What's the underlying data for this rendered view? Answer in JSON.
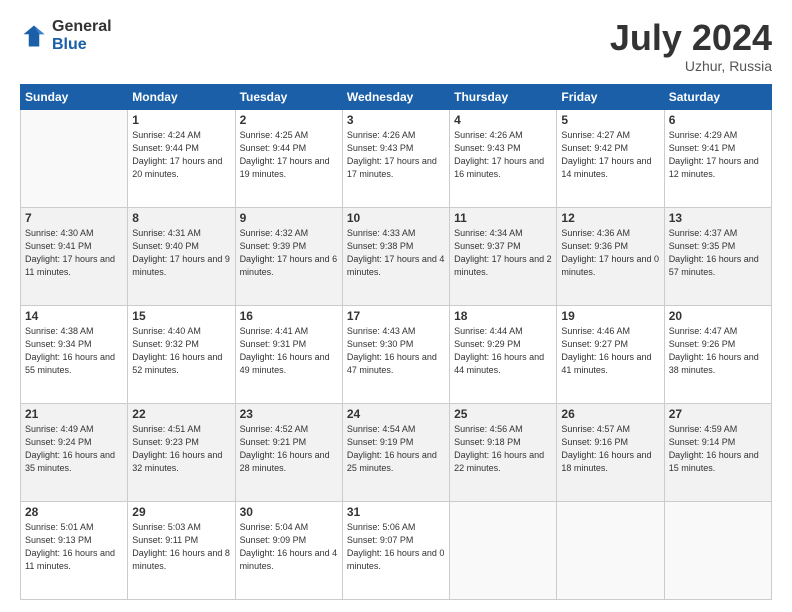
{
  "header": {
    "logo_general": "General",
    "logo_blue": "Blue",
    "month_title": "July 2024",
    "location": "Uzhur, Russia"
  },
  "weekdays": [
    "Sunday",
    "Monday",
    "Tuesday",
    "Wednesday",
    "Thursday",
    "Friday",
    "Saturday"
  ],
  "weeks": [
    [
      {
        "day": "",
        "sunrise": "",
        "sunset": "",
        "daylight": ""
      },
      {
        "day": "1",
        "sunrise": "Sunrise: 4:24 AM",
        "sunset": "Sunset: 9:44 PM",
        "daylight": "Daylight: 17 hours and 20 minutes."
      },
      {
        "day": "2",
        "sunrise": "Sunrise: 4:25 AM",
        "sunset": "Sunset: 9:44 PM",
        "daylight": "Daylight: 17 hours and 19 minutes."
      },
      {
        "day": "3",
        "sunrise": "Sunrise: 4:26 AM",
        "sunset": "Sunset: 9:43 PM",
        "daylight": "Daylight: 17 hours and 17 minutes."
      },
      {
        "day": "4",
        "sunrise": "Sunrise: 4:26 AM",
        "sunset": "Sunset: 9:43 PM",
        "daylight": "Daylight: 17 hours and 16 minutes."
      },
      {
        "day": "5",
        "sunrise": "Sunrise: 4:27 AM",
        "sunset": "Sunset: 9:42 PM",
        "daylight": "Daylight: 17 hours and 14 minutes."
      },
      {
        "day": "6",
        "sunrise": "Sunrise: 4:29 AM",
        "sunset": "Sunset: 9:41 PM",
        "daylight": "Daylight: 17 hours and 12 minutes."
      }
    ],
    [
      {
        "day": "7",
        "sunrise": "Sunrise: 4:30 AM",
        "sunset": "Sunset: 9:41 PM",
        "daylight": "Daylight: 17 hours and 11 minutes."
      },
      {
        "day": "8",
        "sunrise": "Sunrise: 4:31 AM",
        "sunset": "Sunset: 9:40 PM",
        "daylight": "Daylight: 17 hours and 9 minutes."
      },
      {
        "day": "9",
        "sunrise": "Sunrise: 4:32 AM",
        "sunset": "Sunset: 9:39 PM",
        "daylight": "Daylight: 17 hours and 6 minutes."
      },
      {
        "day": "10",
        "sunrise": "Sunrise: 4:33 AM",
        "sunset": "Sunset: 9:38 PM",
        "daylight": "Daylight: 17 hours and 4 minutes."
      },
      {
        "day": "11",
        "sunrise": "Sunrise: 4:34 AM",
        "sunset": "Sunset: 9:37 PM",
        "daylight": "Daylight: 17 hours and 2 minutes."
      },
      {
        "day": "12",
        "sunrise": "Sunrise: 4:36 AM",
        "sunset": "Sunset: 9:36 PM",
        "daylight": "Daylight: 17 hours and 0 minutes."
      },
      {
        "day": "13",
        "sunrise": "Sunrise: 4:37 AM",
        "sunset": "Sunset: 9:35 PM",
        "daylight": "Daylight: 16 hours and 57 minutes."
      }
    ],
    [
      {
        "day": "14",
        "sunrise": "Sunrise: 4:38 AM",
        "sunset": "Sunset: 9:34 PM",
        "daylight": "Daylight: 16 hours and 55 minutes."
      },
      {
        "day": "15",
        "sunrise": "Sunrise: 4:40 AM",
        "sunset": "Sunset: 9:32 PM",
        "daylight": "Daylight: 16 hours and 52 minutes."
      },
      {
        "day": "16",
        "sunrise": "Sunrise: 4:41 AM",
        "sunset": "Sunset: 9:31 PM",
        "daylight": "Daylight: 16 hours and 49 minutes."
      },
      {
        "day": "17",
        "sunrise": "Sunrise: 4:43 AM",
        "sunset": "Sunset: 9:30 PM",
        "daylight": "Daylight: 16 hours and 47 minutes."
      },
      {
        "day": "18",
        "sunrise": "Sunrise: 4:44 AM",
        "sunset": "Sunset: 9:29 PM",
        "daylight": "Daylight: 16 hours and 44 minutes."
      },
      {
        "day": "19",
        "sunrise": "Sunrise: 4:46 AM",
        "sunset": "Sunset: 9:27 PM",
        "daylight": "Daylight: 16 hours and 41 minutes."
      },
      {
        "day": "20",
        "sunrise": "Sunrise: 4:47 AM",
        "sunset": "Sunset: 9:26 PM",
        "daylight": "Daylight: 16 hours and 38 minutes."
      }
    ],
    [
      {
        "day": "21",
        "sunrise": "Sunrise: 4:49 AM",
        "sunset": "Sunset: 9:24 PM",
        "daylight": "Daylight: 16 hours and 35 minutes."
      },
      {
        "day": "22",
        "sunrise": "Sunrise: 4:51 AM",
        "sunset": "Sunset: 9:23 PM",
        "daylight": "Daylight: 16 hours and 32 minutes."
      },
      {
        "day": "23",
        "sunrise": "Sunrise: 4:52 AM",
        "sunset": "Sunset: 9:21 PM",
        "daylight": "Daylight: 16 hours and 28 minutes."
      },
      {
        "day": "24",
        "sunrise": "Sunrise: 4:54 AM",
        "sunset": "Sunset: 9:19 PM",
        "daylight": "Daylight: 16 hours and 25 minutes."
      },
      {
        "day": "25",
        "sunrise": "Sunrise: 4:56 AM",
        "sunset": "Sunset: 9:18 PM",
        "daylight": "Daylight: 16 hours and 22 minutes."
      },
      {
        "day": "26",
        "sunrise": "Sunrise: 4:57 AM",
        "sunset": "Sunset: 9:16 PM",
        "daylight": "Daylight: 16 hours and 18 minutes."
      },
      {
        "day": "27",
        "sunrise": "Sunrise: 4:59 AM",
        "sunset": "Sunset: 9:14 PM",
        "daylight": "Daylight: 16 hours and 15 minutes."
      }
    ],
    [
      {
        "day": "28",
        "sunrise": "Sunrise: 5:01 AM",
        "sunset": "Sunset: 9:13 PM",
        "daylight": "Daylight: 16 hours and 11 minutes."
      },
      {
        "day": "29",
        "sunrise": "Sunrise: 5:03 AM",
        "sunset": "Sunset: 9:11 PM",
        "daylight": "Daylight: 16 hours and 8 minutes."
      },
      {
        "day": "30",
        "sunrise": "Sunrise: 5:04 AM",
        "sunset": "Sunset: 9:09 PM",
        "daylight": "Daylight: 16 hours and 4 minutes."
      },
      {
        "day": "31",
        "sunrise": "Sunrise: 5:06 AM",
        "sunset": "Sunset: 9:07 PM",
        "daylight": "Daylight: 16 hours and 0 minutes."
      },
      {
        "day": "",
        "sunrise": "",
        "sunset": "",
        "daylight": ""
      },
      {
        "day": "",
        "sunrise": "",
        "sunset": "",
        "daylight": ""
      },
      {
        "day": "",
        "sunrise": "",
        "sunset": "",
        "daylight": ""
      }
    ]
  ]
}
